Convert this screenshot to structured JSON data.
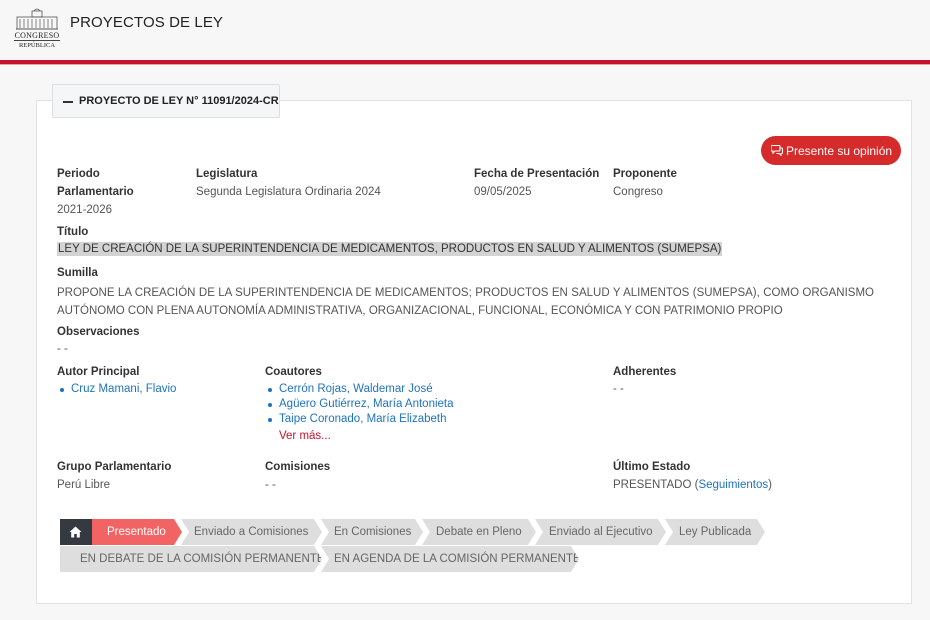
{
  "header": {
    "title": "PROYECTOS DE LEY",
    "logo_line1": "CONGRESO",
    "logo_line2": "REPÚBLICA"
  },
  "tab": {
    "label": "PROYECTO DE LEY N° 11091/2024-CR"
  },
  "opinion_button": {
    "label": "Presente su opinión",
    "icon": "chat-bubbles-icon"
  },
  "fields": {
    "periodo_label_1": "Periodo",
    "periodo_label_2": "Parlamentario",
    "periodo_value": "2021-2026",
    "legislatura_label": "Legislatura",
    "legislatura_value": "Segunda Legislatura Ordinaria 2024",
    "fecha_label": "Fecha de Presentación",
    "fecha_value": "09/05/2025",
    "proponente_label": "Proponente",
    "proponente_value": "Congreso",
    "titulo_label": "Título",
    "titulo_value": "LEY DE CREACIÓN DE LA SUPERINTENDENCIA DE MEDICAMENTOS, PRODUCTOS EN SALUD Y ALIMENTOS (SUMEPSA)",
    "sumilla_label": "Sumilla",
    "sumilla_value": "PROPONE LA CREACIÓN DE LA SUPERINTENDENCIA DE MEDICAMENTOS; PRODUCTOS EN SALUD Y ALIMENTOS (SUMEPSA), COMO ORGANISMO AUTÓNOMO CON PLENA AUTONOMÍA ADMINISTRATIVA, ORGANIZACIONAL, FUNCIONAL, ECONÓMICA Y CON PATRIMONIO PROPIO",
    "observaciones_label": "Observaciones",
    "observaciones_value": "- -",
    "autor_label": "Autor Principal",
    "autor_value": "Cruz Mamani, Flavio",
    "coautores_label": "Coautores",
    "coautores": [
      "Cerrón Rojas, Waldemar José",
      "Agüero Gutiérrez, María Antonieta",
      "Taipe Coronado, María Elizabeth"
    ],
    "ver_mas": "Ver más...",
    "adherentes_label": "Adherentes",
    "adherentes_value": "- -",
    "grupo_label": "Grupo Parlamentario",
    "grupo_value": "Perú Libre",
    "comisiones_label": "Comisiones",
    "comisiones_value": "- -",
    "estado_label": "Último Estado",
    "estado_value": "PRESENTADO",
    "estado_paren_open": "(",
    "estado_link": "Seguimientos",
    "estado_paren_close": ")"
  },
  "steps": [
    {
      "label": "Presentado",
      "active": true
    },
    {
      "label": "Enviado a Comisiones",
      "active": false
    },
    {
      "label": "En Comisiones",
      "active": false
    },
    {
      "label": "Debate en Pleno",
      "active": false
    },
    {
      "label": "Enviado al Ejecutivo",
      "active": false
    },
    {
      "label": "Ley Publicada",
      "active": false
    },
    {
      "label": "EN DEBATE DE LA COMISIÓN PERMANENTE",
      "active": false
    },
    {
      "label": "EN AGENDA DE LA COMISIÓN PERMANENTE",
      "active": false
    }
  ],
  "colors": {
    "accent": "#c8102e",
    "active_step": "#f26464",
    "link": "#1e73be",
    "home": "#343a40",
    "step_bg": "#dedede"
  }
}
